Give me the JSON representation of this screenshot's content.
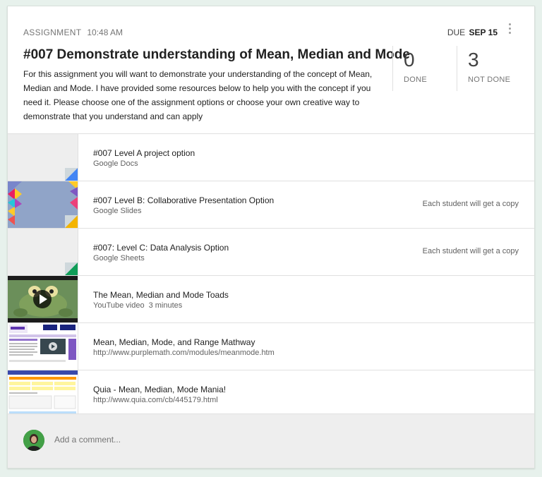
{
  "assignment": {
    "kind": "ASSIGNMENT",
    "time": "10:48 AM",
    "due_prefix": "DUE",
    "due_date": "SEP 15",
    "title": "#007 Demonstrate understanding of Mean, Median and Mode",
    "description": "For this assignment you will want to demonstrate your understanding of the concept of Mean, Median and Mode. I have provided some resources below to help you with the concept if you need it. Please choose one of the assignment options or choose your own creative way to demonstrate that you understand and can apply"
  },
  "stats": {
    "done": {
      "value": "0",
      "label": "DONE"
    },
    "not_done": {
      "value": "3",
      "label": "NOT DONE"
    }
  },
  "attachments": [
    {
      "name": "#007 Level A project option",
      "sub": "Google Docs",
      "icon": "google-docs-icon",
      "accent": "#4285f4"
    },
    {
      "name": "#007 Level B: Collaborative Presentation Option",
      "sub": "Google Slides",
      "note": "Each student will get a copy",
      "icon": "google-slides-icon",
      "accent": "#f4b400"
    },
    {
      "name": "#007: Level C: Data Analysis Option",
      "sub": "Google Sheets",
      "note": "Each student will get a copy",
      "icon": "google-sheets-icon",
      "accent": "#0f9d58"
    },
    {
      "name": "The Mean, Median and Mode Toads",
      "sub": "YouTube video",
      "duration": "3 minutes",
      "icon": "play-icon"
    },
    {
      "name": "Mean, Median, Mode, and Range Mathway",
      "sub": "http://www.purplemath.com/modules/meanmode.htm"
    },
    {
      "name": "Quia - Mean, Median, Mode Mania!",
      "sub": "http://www.quia.com/cb/445179.html"
    }
  ],
  "comment": {
    "placeholder": "Add a comment..."
  }
}
